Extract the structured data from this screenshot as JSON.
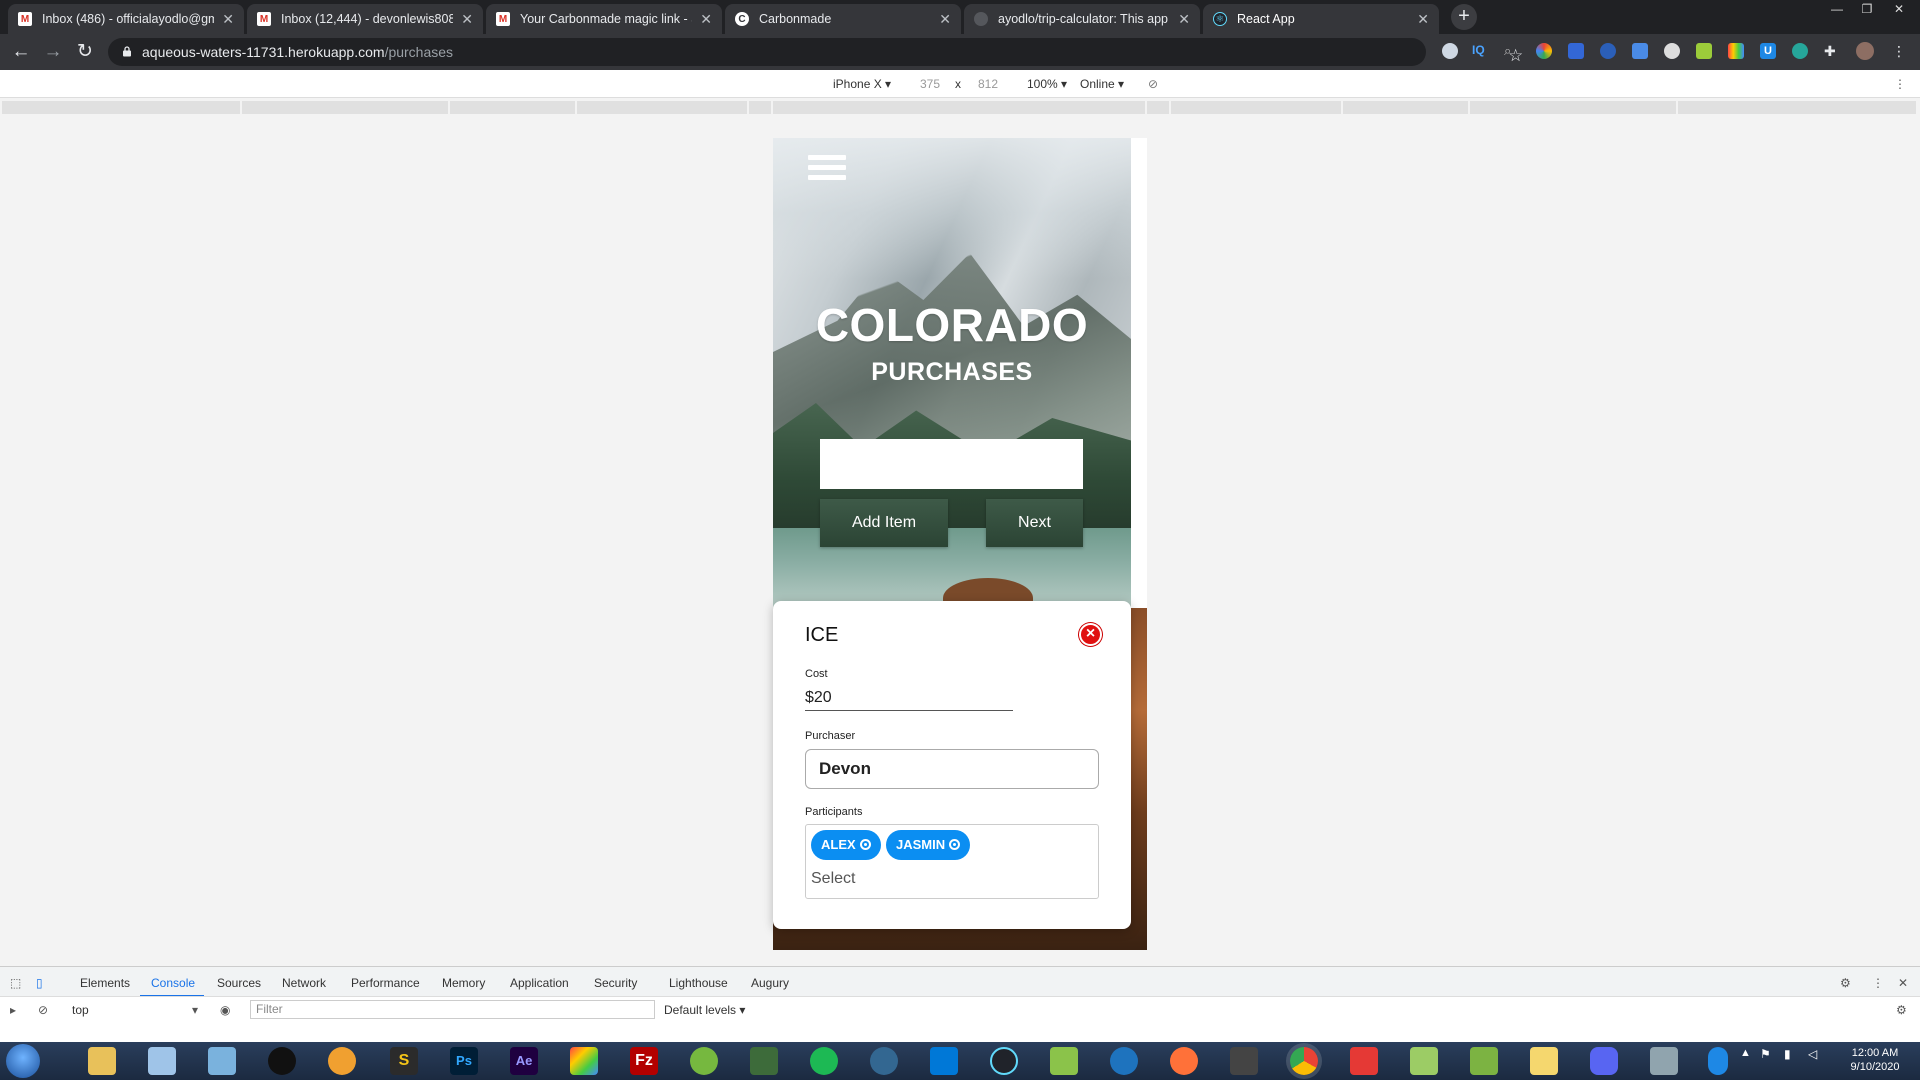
{
  "browser": {
    "tabs": [
      {
        "title": "Inbox (486) - officialayodlo@gm",
        "favicon": "gmail-icon",
        "active": false
      },
      {
        "title": "Inbox (12,444) - devonlewis808@",
        "favicon": "gmail-icon",
        "active": false
      },
      {
        "title": "Your Carbonmade magic link - S",
        "favicon": "gmail-icon",
        "active": false
      },
      {
        "title": "Carbonmade",
        "favicon": "carbonmade-icon",
        "active": false
      },
      {
        "title": "ayodlo/trip-calculator: This app i",
        "favicon": "github-icon",
        "active": false
      },
      {
        "title": "React App",
        "favicon": "react-icon",
        "active": true
      }
    ],
    "url_host": "aqueous-waters-11731.herokuapp.com",
    "url_path": "/purchases"
  },
  "device_toolbar": {
    "device": "iPhone X",
    "width": "375",
    "times": "x",
    "height": "812",
    "zoom": "100%",
    "network": "Online"
  },
  "app": {
    "title": "COLORADO",
    "subtitle": "PURCHASES",
    "item_input_value": "",
    "add_item_label": "Add Item",
    "next_label": "Next"
  },
  "purchase_card": {
    "item_name": "ICE",
    "cost_label": "Cost",
    "cost_value": "$20",
    "purchaser_label": "Purchaser",
    "purchaser_value": "Devon",
    "participants_label": "Participants",
    "participants": [
      "ALEX",
      "JASMIN"
    ],
    "participants_placeholder": "Select"
  },
  "devtools": {
    "tabs": [
      "Elements",
      "Console",
      "Sources",
      "Network",
      "Performance",
      "Memory",
      "Application",
      "Security",
      "Lighthouse",
      "Augury"
    ],
    "active_tab": "Console",
    "context": "top",
    "filter_placeholder": "Filter",
    "levels": "Default levels"
  },
  "taskbar": {
    "time": "12:00 AM",
    "date": "9/10/2020"
  },
  "colors": {
    "chip_blue": "#0b8ef2",
    "button_green": "#3e5a48",
    "close_red": "#e01010",
    "devtools_accent": "#1a73e8"
  }
}
